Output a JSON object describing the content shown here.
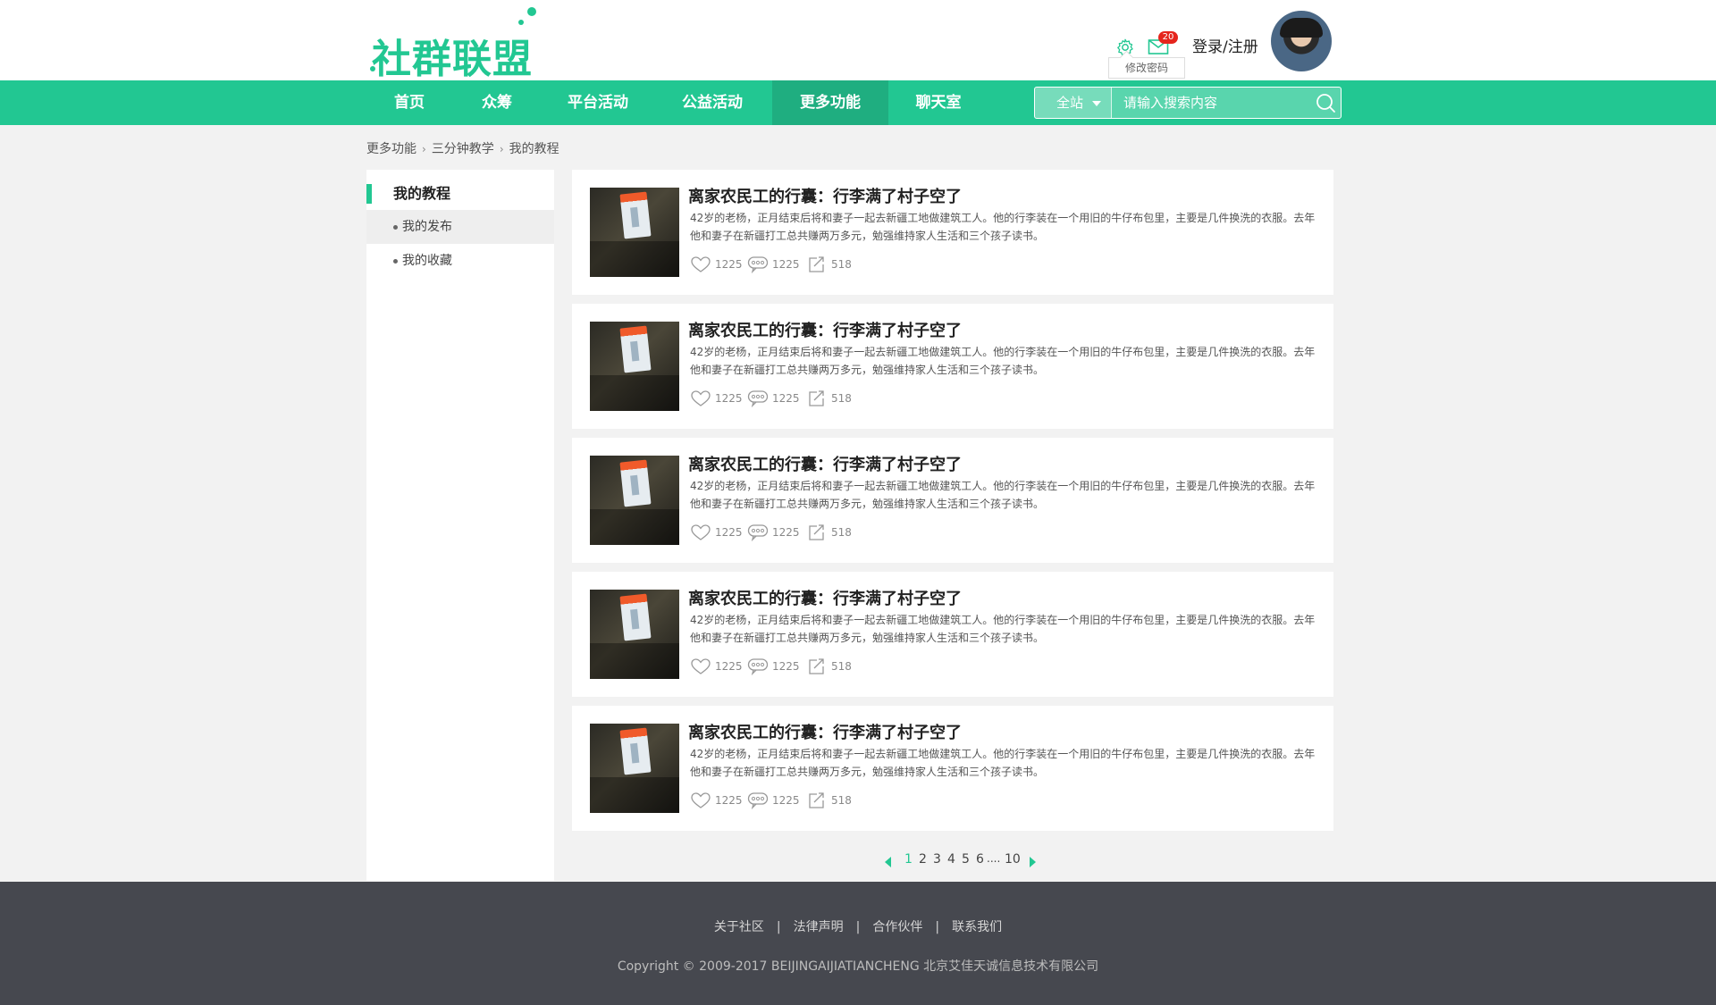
{
  "brand": {
    "logo_text": "社群联盟",
    "accent_color": "#22c792"
  },
  "header": {
    "settings_tooltip": "修改密码",
    "mail_count": "20",
    "login_label": "登录/注册"
  },
  "nav": {
    "items": [
      {
        "label": "首页"
      },
      {
        "label": "众筹"
      },
      {
        "label": "平台活动"
      },
      {
        "label": "公益活动"
      },
      {
        "label": "更多功能",
        "active": true
      },
      {
        "label": "聊天室"
      }
    ],
    "search_scope": "全站",
    "search_placeholder": "请输入搜索内容"
  },
  "breadcrumb": [
    "更多功能",
    "三分钟教学",
    "我的教程"
  ],
  "sidebar": {
    "title": "我的教程",
    "items": [
      {
        "label": "我的发布",
        "active": true
      },
      {
        "label": "我的收藏"
      }
    ]
  },
  "articles": [
    {
      "title": "离家农民工的行囊：行李满了村子空了",
      "desc": "42岁的老杨，正月结束后将和妻子一起去新疆工地做建筑工人。他的行李装在一个用旧的牛仔布包里，主要是几件换洗的衣服。去年他和妻子在新疆打工总共赚两万多元，勉强维持家人生活和三个孩子读书。",
      "likes": "1225",
      "comments": "1225",
      "shares": "518"
    },
    {
      "title": "离家农民工的行囊：行李满了村子空了",
      "desc": "42岁的老杨，正月结束后将和妻子一起去新疆工地做建筑工人。他的行李装在一个用旧的牛仔布包里，主要是几件换洗的衣服。去年他和妻子在新疆打工总共赚两万多元，勉强维持家人生活和三个孩子读书。",
      "likes": "1225",
      "comments": "1225",
      "shares": "518"
    },
    {
      "title": "离家农民工的行囊：行李满了村子空了",
      "desc": "42岁的老杨，正月结束后将和妻子一起去新疆工地做建筑工人。他的行李装在一个用旧的牛仔布包里，主要是几件换洗的衣服。去年他和妻子在新疆打工总共赚两万多元，勉强维持家人生活和三个孩子读书。",
      "likes": "1225",
      "comments": "1225",
      "shares": "518"
    },
    {
      "title": "离家农民工的行囊：行李满了村子空了",
      "desc": "42岁的老杨，正月结束后将和妻子一起去新疆工地做建筑工人。他的行李装在一个用旧的牛仔布包里，主要是几件换洗的衣服。去年他和妻子在新疆打工总共赚两万多元，勉强维持家人生活和三个孩子读书。",
      "likes": "1225",
      "comments": "1225",
      "shares": "518"
    },
    {
      "title": "离家农民工的行囊：行李满了村子空了",
      "desc": "42岁的老杨，正月结束后将和妻子一起去新疆工地做建筑工人。他的行李装在一个用旧的牛仔布包里，主要是几件换洗的衣服。去年他和妻子在新疆打工总共赚两万多元，勉强维持家人生活和三个孩子读书。",
      "likes": "1225",
      "comments": "1225",
      "shares": "518"
    }
  ],
  "pagination": {
    "pages": [
      "1",
      "2",
      "3",
      "4",
      "5",
      "6"
    ],
    "ellipsis": "....",
    "last": "10",
    "current": "1"
  },
  "footer": {
    "links": [
      "关于社区",
      "法律声明",
      "合作伙伴",
      "联系我们"
    ],
    "separator": "|",
    "copyright": "Copyright © 2009-2017 BEIJINGAIJIATIANCHENG 北京艾佳天诚信息技术有限公司"
  }
}
